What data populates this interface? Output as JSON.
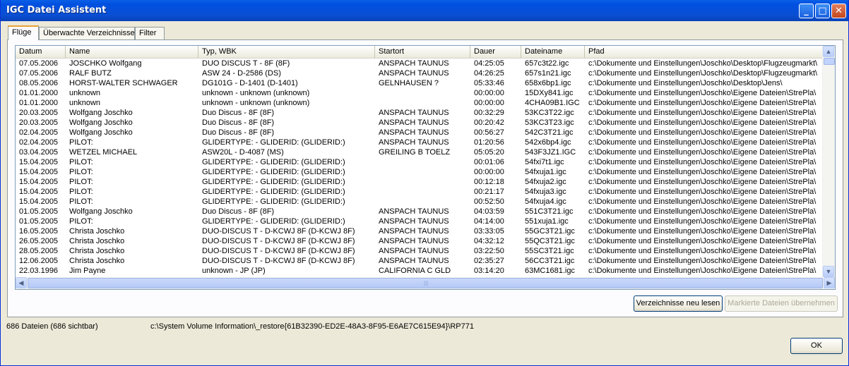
{
  "window": {
    "title": "IGC Datei Assistent"
  },
  "titlebar_buttons": [
    "_",
    "□",
    "✕"
  ],
  "tabs": [
    "Flüge",
    "Überwachte Verzeichnisse",
    "Filter"
  ],
  "columns": [
    "Datum",
    "Name",
    "Typ, WBK",
    "Startort",
    "Dauer",
    "Dateiname",
    "Pfad"
  ],
  "rows": [
    [
      "07.05.2006",
      "JOSCHKO Wolfgang",
      "DUO DISCUS T - 8F (8F)",
      "ANSPACH  TAUNUS",
      "04:25:05",
      "657c3t22.igc",
      "c:\\Dokumente und Einstellungen\\Joschko\\Desktop\\Flugzeugmarkt\\"
    ],
    [
      "07.05.2006",
      "RALF BUTZ",
      "ASW 24 - D-2586 (DS)",
      "ANSPACH  TAUNUS",
      "04:26:25",
      "657s1n21.igc",
      "c:\\Dokumente und Einstellungen\\Joschko\\Desktop\\Flugzeugmarkt\\"
    ],
    [
      "08.05.2006",
      "HORST-WALTER SCHWAGER",
      "DG101G - D-1401 (D-1401)",
      "GELNHAUSEN     ?",
      "05:33:46",
      "658x6bp1.igc",
      "c:\\Dokumente und Einstellungen\\Joschko\\Desktop\\Jens\\"
    ],
    [
      "01.01.2000",
      "unknown",
      "unknown - unknown (unknown)",
      "",
      "00:00:00",
      "15DXy841.igc",
      "c:\\Dokumente und Einstellungen\\Joschko\\Eigene Dateien\\StrePla\\"
    ],
    [
      "01.01.2000",
      "unknown",
      "unknown - unknown (unknown)",
      "",
      "00:00:00",
      "4CHA09B1.IGC",
      "c:\\Dokumente und Einstellungen\\Joschko\\Eigene Dateien\\StrePla\\"
    ],
    [
      "20.03.2005",
      "Wolfgang Joschko",
      "Duo Discus - 8F (8F)",
      "ANSPACH  TAUNUS",
      "00:32:29",
      "53KC3T22.igc",
      "c:\\Dokumente und Einstellungen\\Joschko\\Eigene Dateien\\StrePla\\"
    ],
    [
      "20.03.2005",
      "Wolfgang Joschko",
      "Duo Discus - 8F (8F)",
      "ANSPACH  TAUNUS",
      "00:20:42",
      "53KC3T23.igc",
      "c:\\Dokumente und Einstellungen\\Joschko\\Eigene Dateien\\StrePla\\"
    ],
    [
      "02.04.2005",
      "Wolfgang Joschko",
      "Duo Discus - 8F (8F)",
      "ANSPACH  TAUNUS",
      "00:56:27",
      "542C3T21.igc",
      "c:\\Dokumente und Einstellungen\\Joschko\\Eigene Dateien\\StrePla\\"
    ],
    [
      "02.04.2005",
      "PILOT:",
      "GLIDERTYPE: - GLIDERID: (GLIDERID:)",
      "ANSPACH  TAUNUS",
      "01:20:56",
      "542x6bp4.igc",
      "c:\\Dokumente und Einstellungen\\Joschko\\Eigene Dateien\\StrePla\\"
    ],
    [
      "03.04.2005",
      "WETZEL MICHAEL",
      "ASW20L - D-4087 (MS)",
      "GREILING B TOELZ",
      "05:05:20",
      "543F3JZ1.IGC",
      "c:\\Dokumente und Einstellungen\\Joschko\\Eigene Dateien\\StrePla\\"
    ],
    [
      "15.04.2005",
      "PILOT:",
      "GLIDERTYPE: - GLIDERID: (GLIDERID:)",
      "",
      "00:01:06",
      "54fxi7t1.igc",
      "c:\\Dokumente und Einstellungen\\Joschko\\Eigene Dateien\\StrePla\\"
    ],
    [
      "15.04.2005",
      "PILOT:",
      "GLIDERTYPE: - GLIDERID: (GLIDERID:)",
      "",
      "00:00:00",
      "54fxuja1.igc",
      "c:\\Dokumente und Einstellungen\\Joschko\\Eigene Dateien\\StrePla\\"
    ],
    [
      "15.04.2005",
      "PILOT:",
      "GLIDERTYPE: - GLIDERID: (GLIDERID:)",
      "",
      "00:12:18",
      "54fxuja2.igc",
      "c:\\Dokumente und Einstellungen\\Joschko\\Eigene Dateien\\StrePla\\"
    ],
    [
      "15.04.2005",
      "PILOT:",
      "GLIDERTYPE: - GLIDERID: (GLIDERID:)",
      "",
      "00:21:17",
      "54fxuja3.igc",
      "c:\\Dokumente und Einstellungen\\Joschko\\Eigene Dateien\\StrePla\\"
    ],
    [
      "15.04.2005",
      "PILOT:",
      "GLIDERTYPE: - GLIDERID: (GLIDERID:)",
      "",
      "00:52:50",
      "54fxuja4.igc",
      "c:\\Dokumente und Einstellungen\\Joschko\\Eigene Dateien\\StrePla\\"
    ],
    [
      "01.05.2005",
      "Wolfgang Joschko",
      "Duo Discus - 8F (8F)",
      "ANSPACH  TAUNUS",
      "04:03:59",
      "551C3T21.igc",
      "c:\\Dokumente und Einstellungen\\Joschko\\Eigene Dateien\\StrePla\\"
    ],
    [
      "01.05.2005",
      "PILOT:",
      "GLIDERTYPE: - GLIDERID: (GLIDERID:)",
      "ANSPACH  TAUNUS",
      "04:14:00",
      "551xuja1.igc",
      "c:\\Dokumente und Einstellungen\\Joschko\\Eigene Dateien\\StrePla\\"
    ],
    [
      "16.05.2005",
      "Christa Joschko",
      "DUO-DISCUS T - D-KCWJ  8F (D-KCWJ   8F)",
      "ANSPACH  TAUNUS",
      "03:33:05",
      "55GC3T21.igc",
      "c:\\Dokumente und Einstellungen\\Joschko\\Eigene Dateien\\StrePla\\"
    ],
    [
      "26.05.2005",
      "Christa Joschko",
      "DUO-DISCUS T - D-KCWJ  8F (D-KCWJ   8F)",
      "ANSPACH  TAUNUS",
      "04:32:12",
      "55QC3T21.igc",
      "c:\\Dokumente und Einstellungen\\Joschko\\Eigene Dateien\\StrePla\\"
    ],
    [
      "28.05.2005",
      "Christa Joschko",
      "DUO-DISCUS T - D-KCWJ  8F (D-KCWJ   8F)",
      "ANSPACH  TAUNUS",
      "03:22:50",
      "55SC3T21.igc",
      "c:\\Dokumente und Einstellungen\\Joschko\\Eigene Dateien\\StrePla\\"
    ],
    [
      "12.06.2005",
      "Christa Joschko",
      "DUO-DISCUS T - D-KCWJ  8F (D-KCWJ   8F)",
      "ANSPACH  TAUNUS",
      "02:35:27",
      "56CC3T21.igc",
      "c:\\Dokumente und Einstellungen\\Joschko\\Eigene Dateien\\StrePla\\"
    ],
    [
      "22.03.1996",
      "Jim Payne",
      "unknown - JP (JP)",
      "CALIFORNIA C GLD",
      "03:14:20",
      "63MC1681.igc",
      "c:\\Dokumente und Einstellungen\\Joschko\\Eigene Dateien\\StrePla\\"
    ]
  ],
  "buttons": {
    "reload": "Verzeichnisse neu lesen",
    "apply": "Markierte Dateien übernehmen",
    "ok": "OK"
  },
  "status": {
    "count": "686 Dateien (686 sichtbar)",
    "path": "c:\\System Volume Information\\_restore{61B32390-ED2E-48A3-8F95-E6AE7C615E94}\\RP771"
  },
  "scroll_glyphs": {
    "up": "▲",
    "down": "▼",
    "left": "◀",
    "right": "▶",
    "grip": "|||"
  }
}
